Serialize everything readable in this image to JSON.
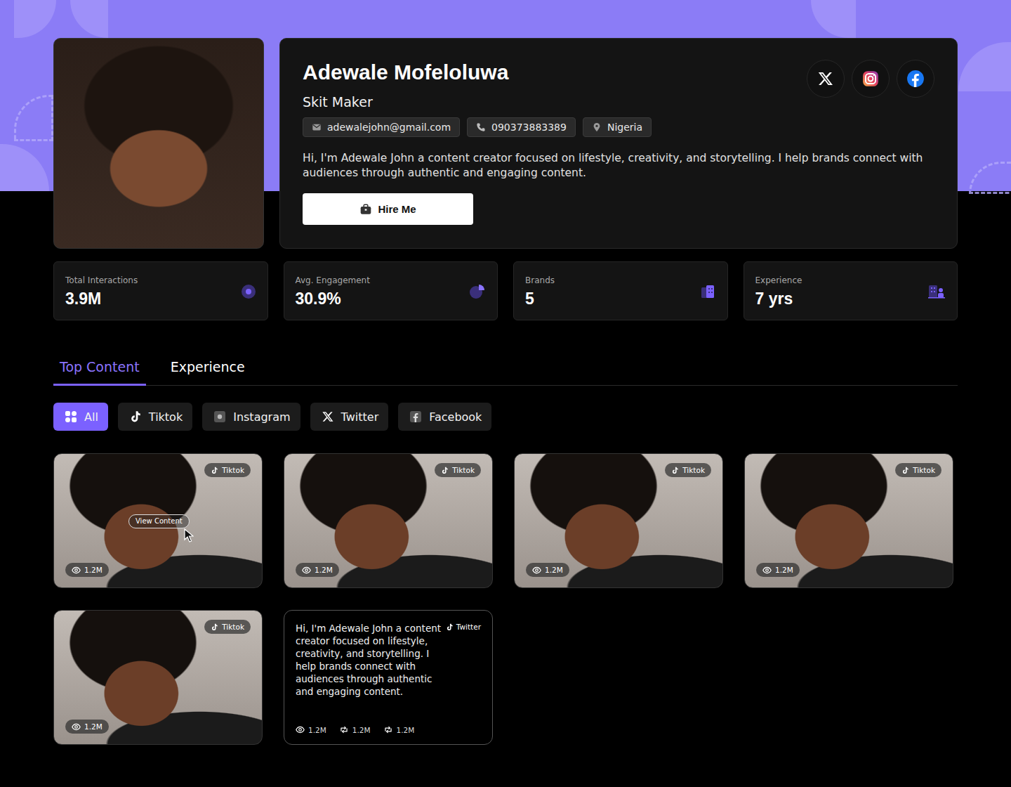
{
  "profile": {
    "name": "Adewale Mofeloluwa",
    "role": "Skit Maker",
    "email": "adewalejohn@gmail.com",
    "phone": "090373883389",
    "location": "Nigeria",
    "bio": "Hi, I'm Adewale John a content creator focused on lifestyle, creativity, and storytelling. I help brands connect with audiences through authentic and engaging content.",
    "hire_button": "Hire Me"
  },
  "stats": [
    {
      "label": "Total Interactions",
      "value": "3.9M"
    },
    {
      "label": "Avg. Engagement",
      "value": "30.9%"
    },
    {
      "label": "Brands",
      "value": "5"
    },
    {
      "label": "Experience",
      "value": "7 yrs"
    }
  ],
  "tabs": [
    {
      "label": "Top Content",
      "selected": true
    },
    {
      "label": "Experience",
      "selected": false
    }
  ],
  "filters": [
    {
      "label": "All",
      "selected": true
    },
    {
      "label": "Tiktok",
      "selected": false
    },
    {
      "label": "Instagram",
      "selected": false
    },
    {
      "label": "Twitter",
      "selected": false
    },
    {
      "label": "Facebook",
      "selected": false
    }
  ],
  "content": [
    {
      "kind": "video",
      "platform": "Tiktok",
      "views": "1.2M",
      "hovered": true,
      "hover_label": "View Content"
    },
    {
      "kind": "video",
      "platform": "Tiktok",
      "views": "1.2M",
      "hovered": false
    },
    {
      "kind": "video",
      "platform": "Tiktok",
      "views": "1.2M",
      "hovered": false
    },
    {
      "kind": "video",
      "platform": "Tiktok",
      "views": "1.2M",
      "hovered": false
    },
    {
      "kind": "video",
      "platform": "Tiktok",
      "views": "1.2M",
      "hovered": false
    },
    {
      "kind": "text",
      "platform": "Twitter",
      "text": "Hi, I'm Adewale John a content creator focused on lifestyle, creativity, and storytelling. I help brands connect with audiences through authentic and engaging content.",
      "views": "1.2M",
      "reposts": "1.2M",
      "shares": "1.2M"
    }
  ]
}
